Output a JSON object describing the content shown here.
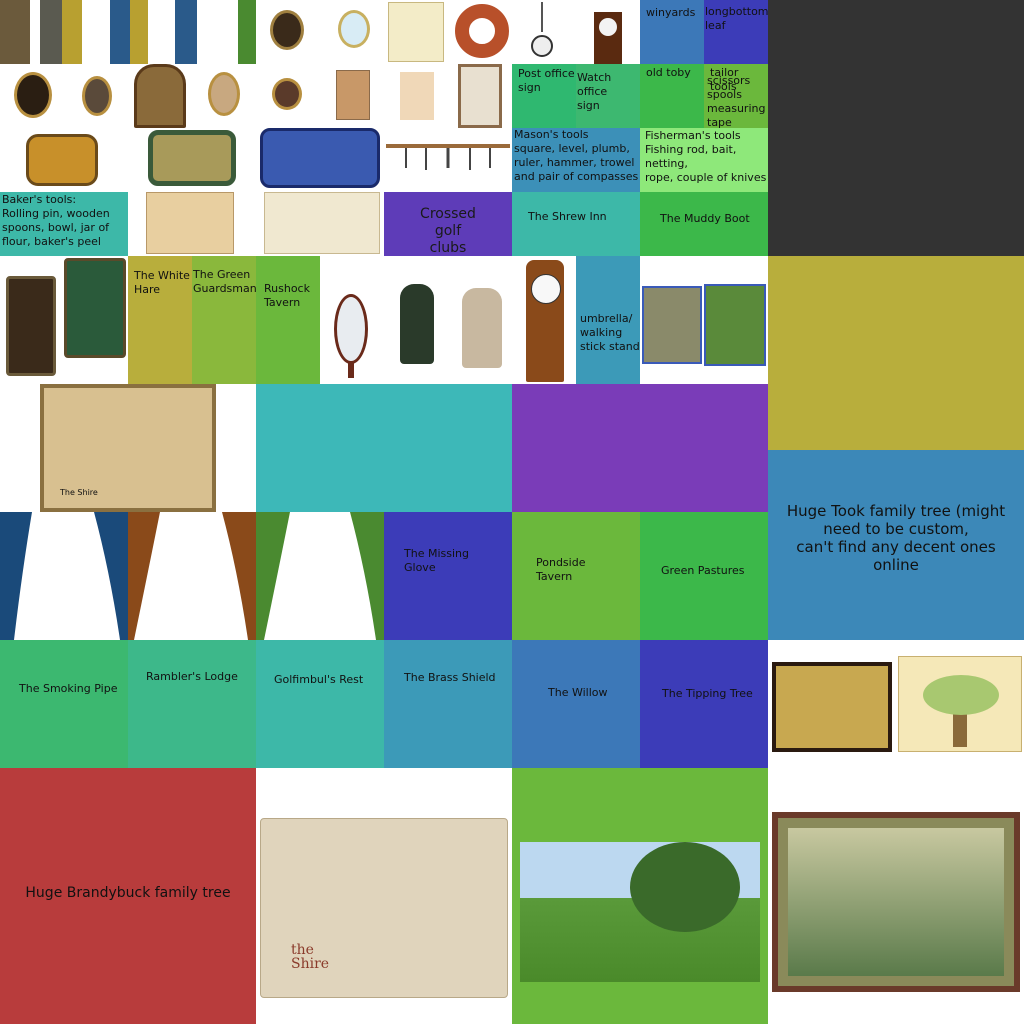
{
  "tiles": {
    "winyards": "winyards",
    "longbottom": "longbottom\nleaf",
    "post_office": "Post office\nsign",
    "watch_office": "Watch office\nsign",
    "old_toby": "old toby",
    "tailor_tools": "tailor tools",
    "scissors": "scissors\nspools\nmeasuring\ntape",
    "masons_tools": "Mason's tools\nsquare, level, plumb,\nruler, hammer, trowel\nand pair of compasses",
    "fishermans_tools": "Fisherman's tools\nFishing rod, bait, netting,\nrope, couple of knives",
    "bakers_tools": "Baker's tools:\nRolling pin, wooden\nspoons, bowl, jar of\nflour, baker's peel",
    "crossed_golf_clubs": "Crossed golf\nclubs",
    "shrew_inn": "The Shrew Inn",
    "muddy_boot": "The Muddy Boot",
    "white_hare": "The White\nHare",
    "green_guardsman": "The Green\nGuardsman",
    "rushock_tavern": "Rushock\nTavern",
    "umbrella_stand": "umbrella/\nwalking\nstick stand",
    "missing_glove": "The Missing\nGlove",
    "pondside_tavern": "Pondside\nTavern",
    "green_pastures": "Green Pastures",
    "took_tree": "Huge Took family tree (might\nneed to be custom,\ncan't find any decent ones\nonline",
    "smoking_pipe": "The Smoking Pipe",
    "ramblers_lodge": "Rambler's Lodge",
    "golfimbuls_rest": "Golfimbul's Rest",
    "brass_shield": "The Brass Shield",
    "willow": "The Willow",
    "tipping_tree": "The Tipping Tree",
    "brandybuck_tree": "Huge Brandybuck family tree",
    "shire_map_label": "the\nShire",
    "shire_map_label2": "The Shire"
  },
  "colors": {
    "teal": "#3db8a8",
    "green": "#2fb870",
    "lime": "#6bb83c",
    "olive": "#b8ae3c",
    "purple": "#5e3cb8",
    "violet": "#7a3cb8",
    "blue": "#3c78b8",
    "indigo": "#3c3cb8",
    "red": "#b83c3c",
    "dark": "#333333",
    "lightgreen": "#8ee87a"
  }
}
